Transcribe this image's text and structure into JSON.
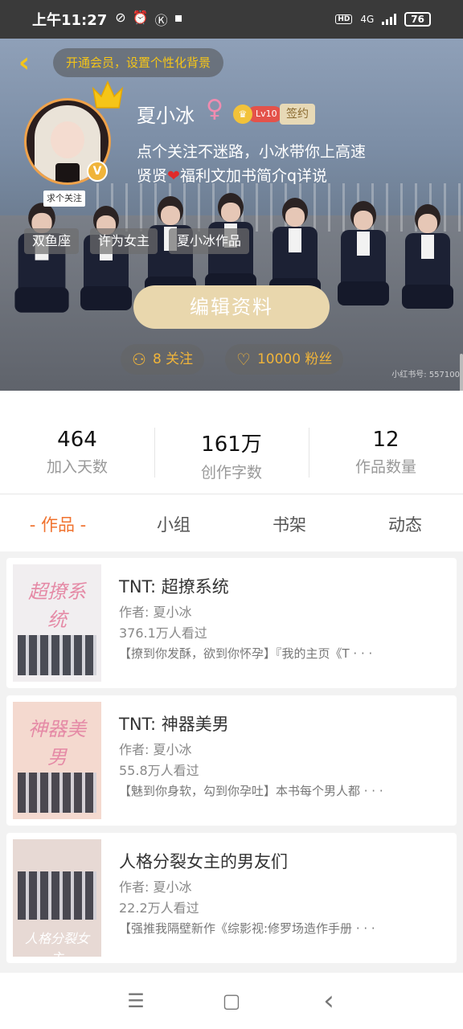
{
  "status_bar": {
    "time": "上午11:27",
    "network": "4G",
    "battery": "76",
    "hd": "HD"
  },
  "header": {
    "vip_prompt": "开通会员，设置个性化背景",
    "follow_tag": "求个关注",
    "username": "夏小冰",
    "gender_symbol": "♀",
    "level": "Lv10",
    "signed_label": "签约",
    "bio_line1": "点个关注不迷路，小冰带你上高速",
    "bio_line2_a": "贤贤",
    "bio_heart": "❤",
    "bio_line2_b": "福利文加书简介q详说",
    "tags": [
      "双鱼座",
      "许为女主",
      "夏小冰作品"
    ],
    "edit_button": "编辑资料",
    "following": "8 关注",
    "fans": "10000 粉丝",
    "watermark": "小红书号: 557100"
  },
  "stats": [
    {
      "value": "464",
      "label": "加入天数"
    },
    {
      "value": "161万",
      "label": "创作字数"
    },
    {
      "value": "12",
      "label": "作品数量"
    }
  ],
  "tabs": [
    "- 作品 -",
    "小组",
    "书架",
    "动态"
  ],
  "books": [
    {
      "cover_text": "超撩系统",
      "title": "TNT: 超撩系统",
      "author": "作者: 夏小冰",
      "views": "376.1万人看过",
      "desc": "【撩到你发酥，欲到你怀孕】『我的主页《T · · ·",
      "cover_bg": "#f1eef0"
    },
    {
      "cover_text": "神器美男",
      "title": "TNT: 神器美男",
      "author": "作者: 夏小冰",
      "views": "55.8万人看过",
      "desc": "【魅到你身软，勾到你孕吐】本书每个男人都 · · ·",
      "cover_bg": "#f4d9cf"
    },
    {
      "cover_text": "人格分裂女主",
      "title": "人格分裂女主的男友们",
      "author": "作者: 夏小冰",
      "views": "22.2万人看过",
      "desc": "【强推我隔壁新作《综影视:修罗场造作手册 · · ·",
      "cover_bg": "#e7d9d4"
    }
  ],
  "nav": {
    "menu_icon": "☰",
    "home_icon": "▢",
    "back_icon": "‹"
  }
}
